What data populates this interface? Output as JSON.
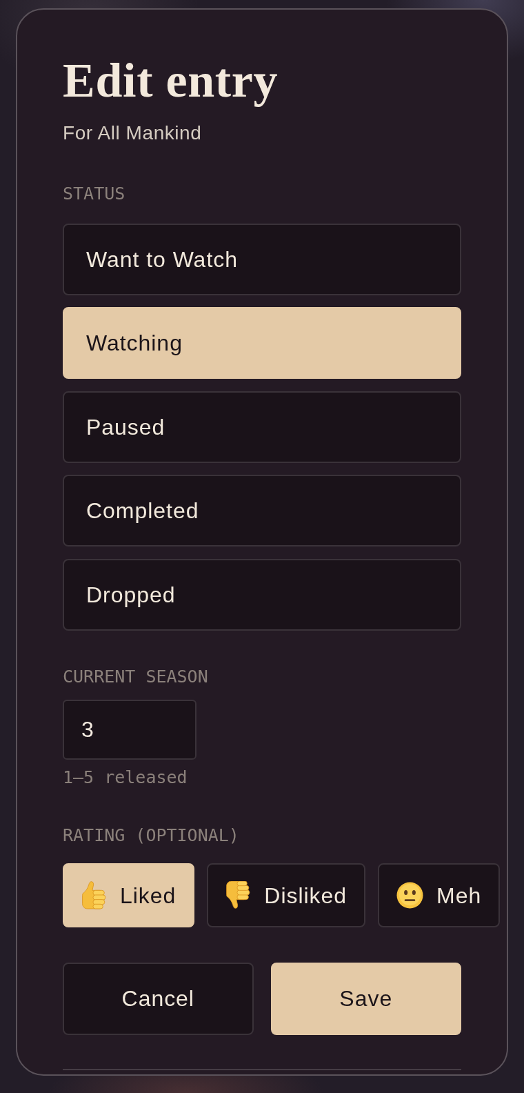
{
  "dialog": {
    "title": "Edit entry",
    "subtitle": "For All Mankind"
  },
  "status": {
    "label": "STATUS",
    "options": [
      {
        "label": "Want to Watch",
        "selected": false
      },
      {
        "label": "Watching",
        "selected": true
      },
      {
        "label": "Paused",
        "selected": false
      },
      {
        "label": "Completed",
        "selected": false
      },
      {
        "label": "Dropped",
        "selected": false
      }
    ]
  },
  "current_season": {
    "label": "CURRENT SEASON",
    "value": "3",
    "hint": "1–5 released"
  },
  "rating": {
    "label": "RATING (OPTIONAL)",
    "options": [
      {
        "kind": "liked",
        "label": "Liked",
        "selected": true
      },
      {
        "kind": "disliked",
        "label": "Disliked",
        "selected": false
      },
      {
        "kind": "meh",
        "label": "Meh",
        "selected": false
      }
    ]
  },
  "buttons": [
    {
      "kind": "secondary",
      "label": "Cancel"
    },
    {
      "kind": "primary",
      "label": "Save"
    }
  ]
}
